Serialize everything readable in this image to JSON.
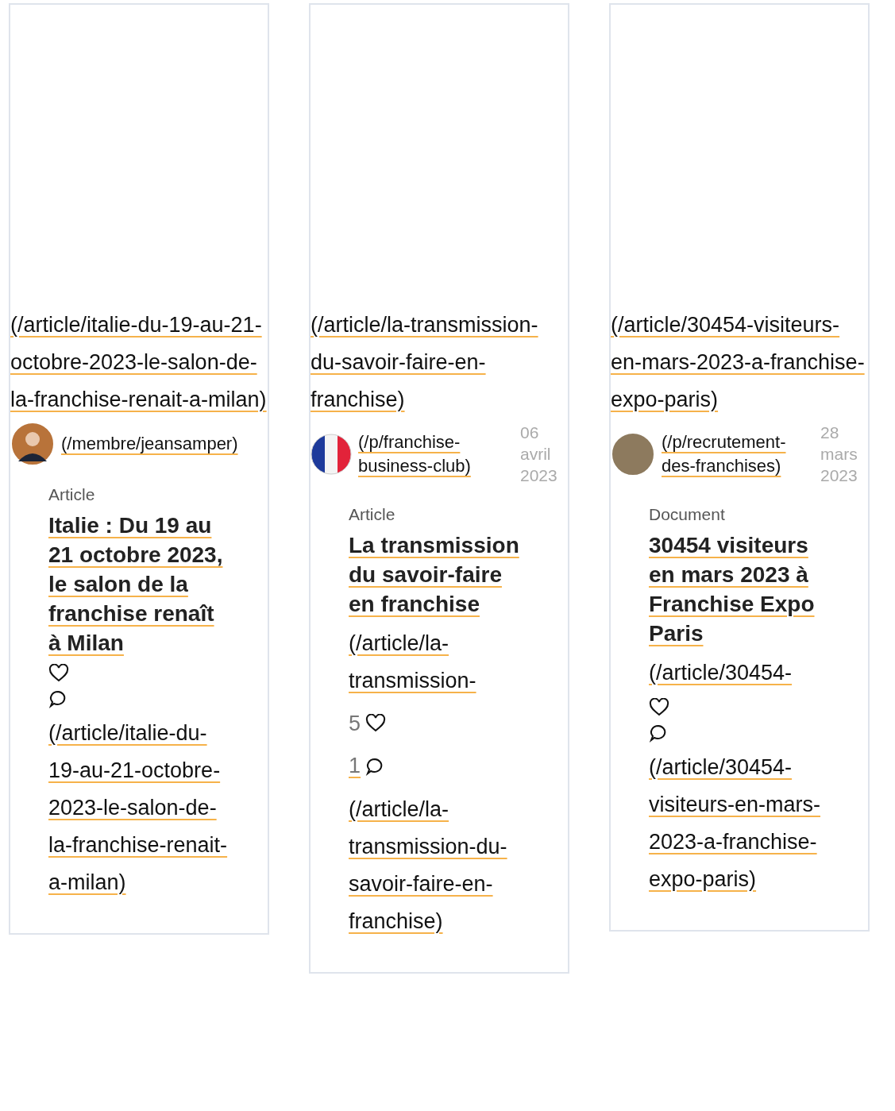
{
  "cards": [
    {
      "image_link": "(/article/italie-du-19-au-21-octobre-2023-le-salon-de-la-franchise-renait-a-milan)",
      "avatar": {
        "kind": "person"
      },
      "author_link": "(/membre/jeansamper)",
      "type": "Article",
      "title": "Italie : Du 19 au 21 octobre 2023, le salon de la franchise renaît à Milan",
      "link": "(/article/italie-du-19-au-21-octobre-2023-le-salon-de-la-franchise-renait-a-milan)"
    },
    {
      "image_link": "(/article/la-transmission-du-savoir-faire-en-franchise)",
      "avatar": {
        "kind": "flag"
      },
      "author_link": "(/p/franchise-business-club)",
      "date": "06 avril 2023",
      "type": "Article",
      "title": "La transmission du savoir-faire en franchise",
      "preview_link": "(/article/la-transmission-",
      "likes": "5",
      "comments": "1",
      "link": "(/article/la-transmission-du-savoir-faire-en-franchise)"
    },
    {
      "image_link": "(/article/30454-visiteurs-en-mars-2023-a-franchise-expo-paris)",
      "avatar": {
        "kind": "group"
      },
      "author_link": "(/p/recrutement-des-franchises)",
      "date": "28 mars 2023",
      "type": "Document",
      "title": "30454 visiteurs en mars 2023 à Franchise Expo Paris",
      "preview_link": "(/article/30454-",
      "link": "(/article/30454-visiteurs-en-mars-2023-a-franchise-expo-paris)"
    }
  ]
}
